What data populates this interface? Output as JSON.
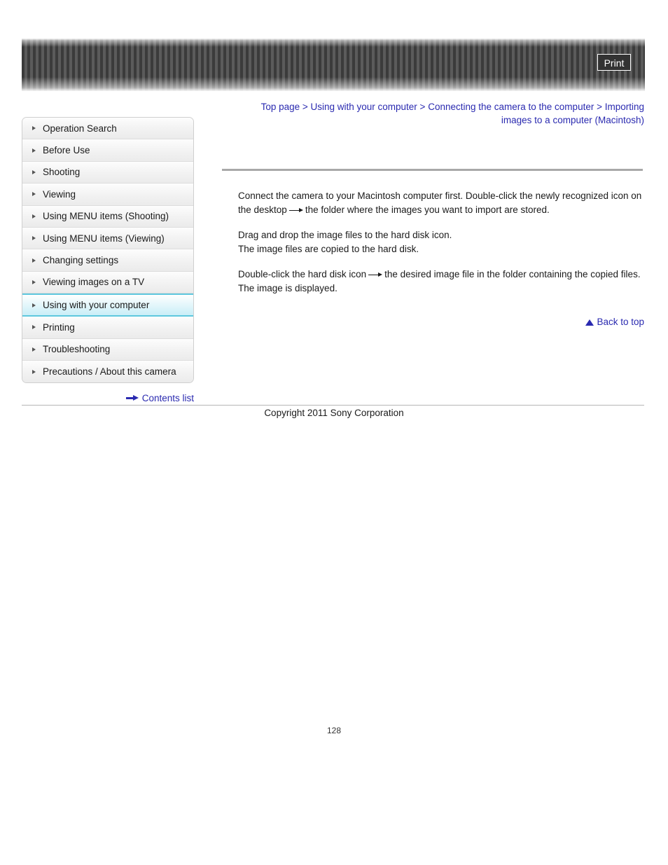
{
  "header": {
    "print_label": "Print"
  },
  "breadcrumb": {
    "separator": ">",
    "items": [
      "Top page",
      "Using with your computer",
      "Connecting the camera to the computer",
      "Importing images to a computer (Macintosh)"
    ],
    "line1": "Top page > Using with your computer > Connecting the camera to the computer > Importing",
    "line2": "images to a computer (Macintosh)"
  },
  "sidebar": {
    "items": [
      {
        "label": "Operation Search",
        "active": false
      },
      {
        "label": "Before Use",
        "active": false
      },
      {
        "label": "Shooting",
        "active": false
      },
      {
        "label": "Viewing",
        "active": false
      },
      {
        "label": "Using MENU items (Shooting)",
        "active": false
      },
      {
        "label": "Using MENU items (Viewing)",
        "active": false
      },
      {
        "label": "Changing settings",
        "active": false
      },
      {
        "label": "Viewing images on a TV",
        "active": false
      },
      {
        "label": "Using with your computer",
        "active": true
      },
      {
        "label": "Printing",
        "active": false
      },
      {
        "label": "Troubleshooting",
        "active": false
      },
      {
        "label": "Precautions / About this camera",
        "active": false
      }
    ],
    "contents_list_label": "Contents list"
  },
  "content": {
    "para1_part1": "Connect the camera to your Macintosh computer first. Double-click the newly recognized icon on the desktop",
    "para1_part2": "the folder where the images you want to import are stored.",
    "para2_line1": "Drag and drop the image files to the hard disk icon.",
    "para2_line2": "The image files are copied to the hard disk.",
    "para3_part1": "Double-click the hard disk icon",
    "para3_part2": "the desired image file in the folder containing the copied files.",
    "para3_line2": "The image is displayed.",
    "back_to_top_label": "Back to top"
  },
  "footer": {
    "copyright": "Copyright 2011 Sony Corporation",
    "page_number": "128"
  },
  "colors": {
    "link": "#2a2ab0",
    "active_nav": "#c9eef7",
    "active_border": "#5ec8de",
    "banner_dark": "#3b3b3b",
    "banner_light": "#5b5b5b",
    "rule": "#a8a8a8"
  }
}
